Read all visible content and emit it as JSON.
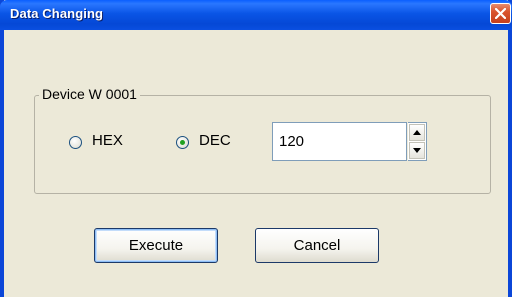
{
  "window": {
    "title": "Data Changing"
  },
  "device_group": {
    "label": "Device W 0001"
  },
  "format": {
    "hex_label": "HEX",
    "dec_label": "DEC",
    "selected": "DEC"
  },
  "value_field": {
    "value": "120"
  },
  "buttons": {
    "execute_label": "Execute",
    "cancel_label": "Cancel"
  },
  "colors": {
    "titlebar": "#0a55e6",
    "close_button": "#d9542e",
    "dialog_face": "#ece9d8",
    "radio_dot": "#21a121"
  }
}
